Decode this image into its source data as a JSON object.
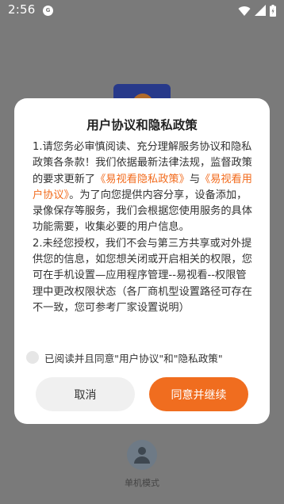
{
  "status_bar": {
    "time": "2:56",
    "notification_badge": "Ⓜ"
  },
  "background": {
    "user_mode_label": "单机模式"
  },
  "dialog": {
    "title": "用户协议和隐私政策",
    "body": {
      "p1_prefix": "1.请您务必审慎阅读、充分理解服务协议和隐私政策各条款！我们依据最新法律法规，监督政策的要求更新了",
      "privacy_link": "《易视看隐私政策》",
      "p1_and": "与",
      "user_agreement_link": "《易视看用户协议》",
      "p1_suffix": "。为了向您提供内容分享，设备添加，录像保存等服务，我们会根据您使用服务的具体功能需要，收集必要的用户信息。",
      "p2": "2.未经您授权，我们不会与第三方共享或对外提供您的信息，如您想关闭或开启相关的权限，您可在手机设置—应用程序管理--易视看--权限管理中更改权限状态（各厂商机型设置路径可存在不一致，您可参考厂家设置说明）"
    },
    "agree_text": "已阅读并且同意\"用户协议\"和\"隐私政策\"",
    "cancel_label": "取消",
    "accept_label": "同意并继续"
  },
  "colors": {
    "accent": "#f06d1f",
    "link": "#f26b1d"
  }
}
